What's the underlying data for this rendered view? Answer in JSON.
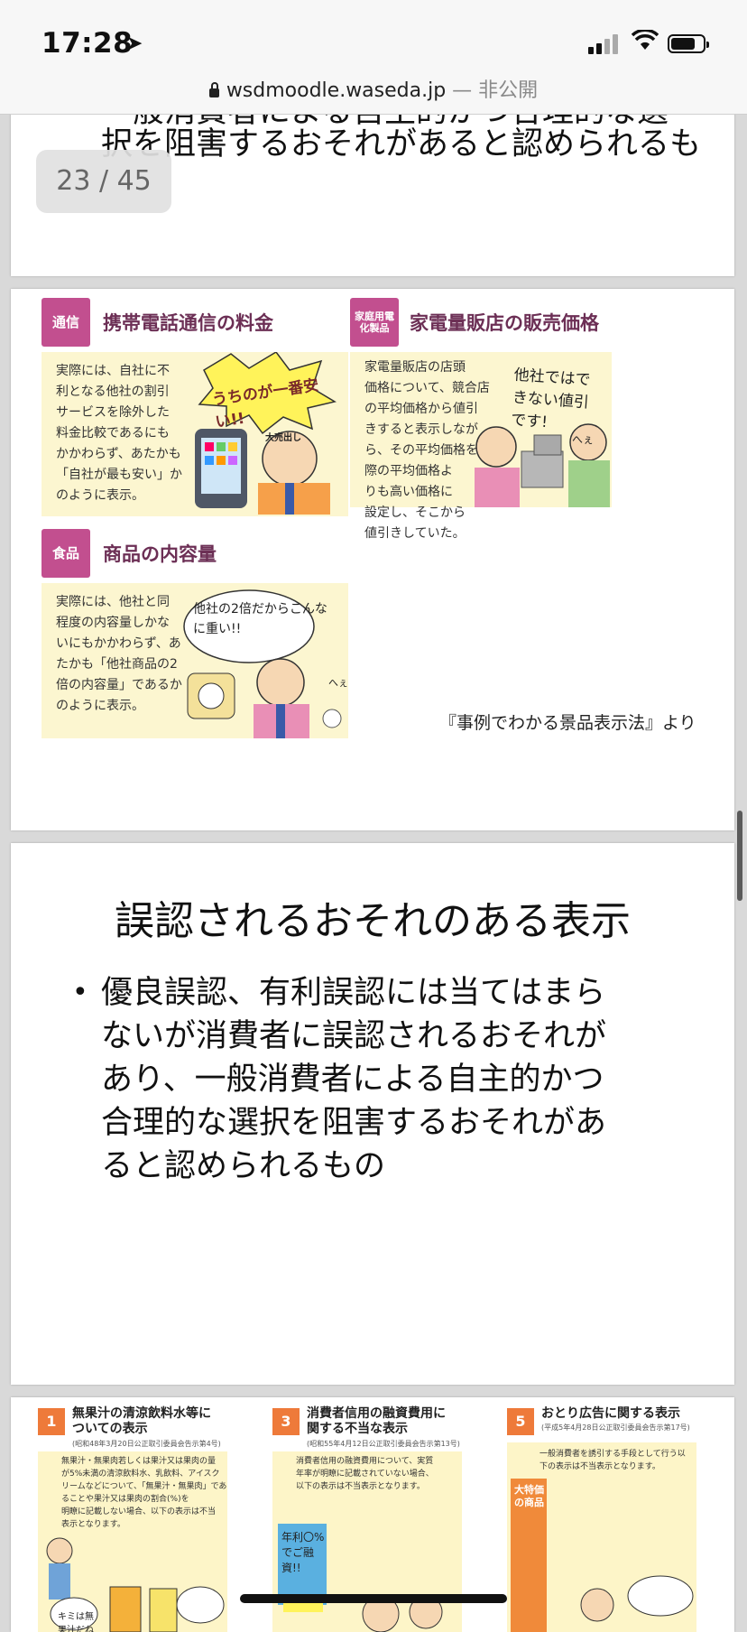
{
  "status": {
    "time": "17:28"
  },
  "browser": {
    "domain": "wsdmoodle.waseda.jp",
    "visibility": " — 非公開"
  },
  "viewer": {
    "page_indicator": "23 / 45"
  },
  "slide_prev": {
    "lines": [
      "一般消費者による自主的かつ合理的な選",
      "択を阻害するおそれがあると認められるも"
    ]
  },
  "slide_examples": {
    "panels": [
      {
        "tag": "通信",
        "title": "携帯電話通信の料金",
        "text": "実際には、自社に不\n利となる他社の割引\nサービスを除外した\n料金比較であるにも\nかかわらず、あたかも\n「自社が最も安い」か\nのように表示。",
        "bubble": "うちのが一番安い!!",
        "sign": "大売出し"
      },
      {
        "tag": "家庭用電化製品",
        "title": "家電量販店の販売価格",
        "text": "家電量販店の店頭\n価格について、競合店\nの平均価格から値引\nきすると表示しなが\nら、その平均価格を実\n際の平均価格よ\nりも高い価格に\n設定し、そこから\n値引きしていた。",
        "bubble": "他社ではできない値引です!",
        "aside": "へぇ"
      },
      {
        "tag": "食品",
        "title": "商品の内容量",
        "text": "実際には、他社と同\n程度の内容量しかな\nいにもかかわらず、あ\nたかも「他社商品の2\n倍の内容量」であるか\nのように表示。",
        "bubble": "他社の2倍だからこんなに重い!!",
        "aside": "へぇ"
      }
    ],
    "source": "『事例でわかる景品表示法』より"
  },
  "slide_main": {
    "title": "誤認されるおそれのある表示",
    "bullet_lines": [
      "優良誤認、有利誤認には当てはまら",
      "ないが消費者に誤認されるおそれが",
      "あり、一般消費者による自主的かつ",
      "合理的な選択を阻害するおそれがあ",
      "ると認められるもの"
    ]
  },
  "slide_next": {
    "cards": [
      {
        "num": "1",
        "title": "無果汁の清涼飲料水等に\nついての表示",
        "sub": "(昭和48年3月20日公正取引委員会告示第4号)",
        "body": "無果汁・無果肉若しくは果汁又は果肉の量\nが5%未満の清涼飲料水、乳飲料、アイスク\nリームなどについて、「無果汁・無果肉」であ\nることや果汁又は果肉の割合(%)を\n明瞭に記載しない場合、以下の表示は不当\n表示となります。",
        "bubble": "キミは無果汁だね"
      },
      {
        "num": "3",
        "title": "消費者信用の融資費用に\n関する不当な表示",
        "sub": "(昭和55年4月12日公正取引委員会告示第13号)",
        "body": "消費者信用の融資費用について、実質\n年率が明瞭に記載されていない場合、\n以下の表示は不当表示となります。",
        "bubble": "年利〇%でご融資!!"
      },
      {
        "num": "5",
        "title": "おとり広告に関する表示",
        "sub": "(平成5年4月28日公正取引委員会告示第17号)",
        "body": "一般消費者を誘引する手段として行う以\n下の表示は不当表示となります。",
        "bubble": "大特価の商品"
      }
    ]
  }
}
